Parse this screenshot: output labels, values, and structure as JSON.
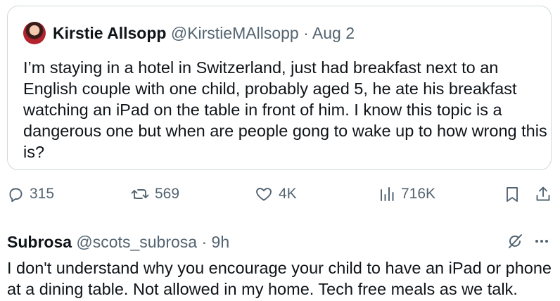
{
  "quoted_tweet": {
    "author_name": "Kirstie Allsopp",
    "handle": "@KirstieMAllsopp",
    "separator": "·",
    "date": "Aug 2",
    "text": "I’m staying in a hotel in Switzerland, just had breakfast next to an English couple with one child, probably aged 5, he ate his breakfast watching an iPad on the table in front of him. I know this topic is a dangerous one but when are people gong to wake up to how wrong this is?"
  },
  "action_bar": {
    "replies": "315",
    "reposts": "569",
    "likes": "4K",
    "views": "716K"
  },
  "reply": {
    "author_name": "Subrosa",
    "handle": "@scots_subrosa",
    "separator": "·",
    "time": "9h",
    "text": "I don't understand why you encourage your child to have an iPad or phone at a dining table. Not allowed in my home. Tech free meals as we talk."
  },
  "icons": [
    "reply-icon",
    "repost-icon",
    "like-icon",
    "views-icon",
    "bookmark-icon",
    "share-icon",
    "grok-icon",
    "more-icon"
  ],
  "colors": {
    "text": "#0f1419",
    "secondary": "#536471",
    "border": "#cfd9de"
  }
}
